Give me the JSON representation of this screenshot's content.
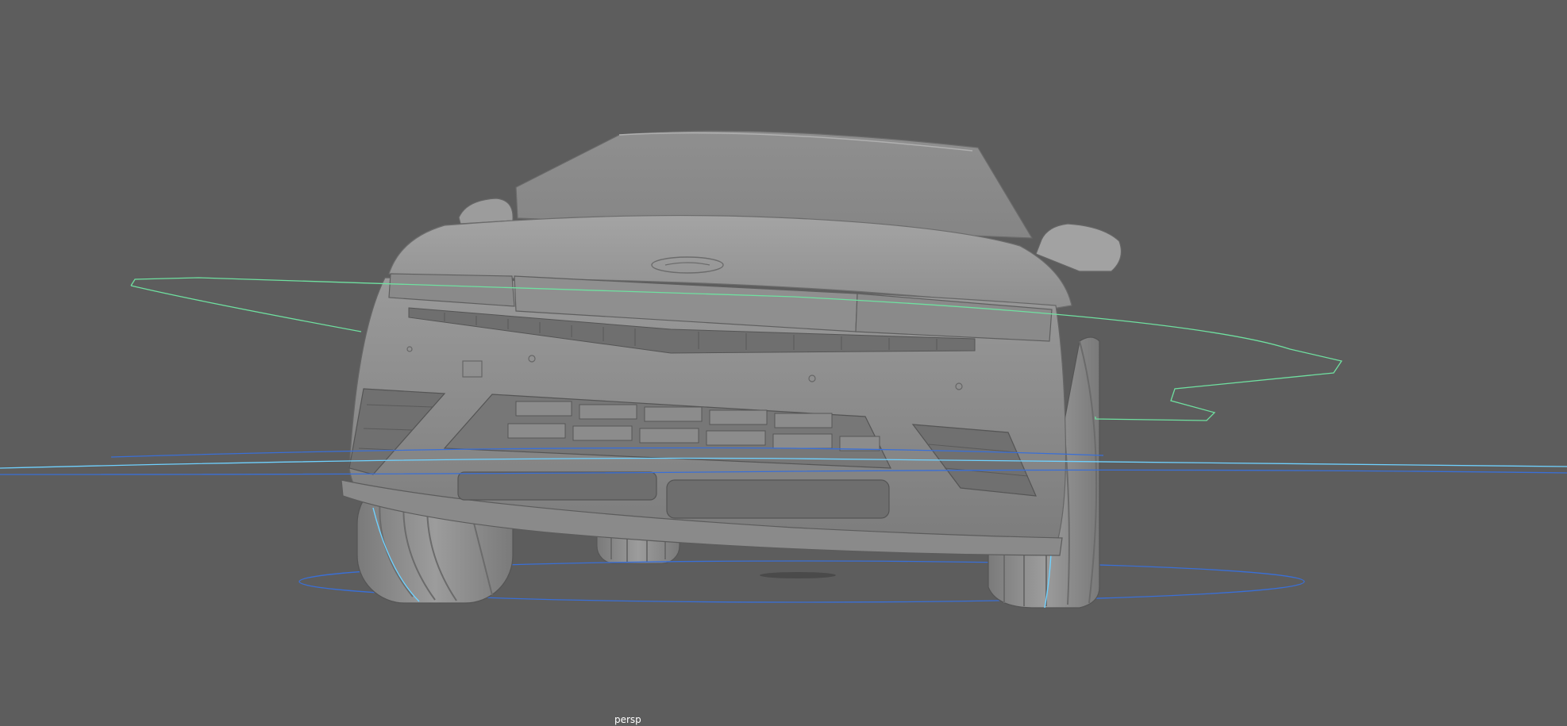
{
  "viewport": {
    "camera_name": "persp",
    "background_color": "#5d5d5d"
  },
  "scene": {
    "model": "car-front-view",
    "curves": [
      {
        "name": "green-control-curve",
        "color": "#6fe0a0"
      },
      {
        "name": "blue-ground-circle",
        "color": "#3a6fd6"
      },
      {
        "name": "cyan-horizon-curve",
        "color": "#6fd1ff"
      }
    ]
  }
}
